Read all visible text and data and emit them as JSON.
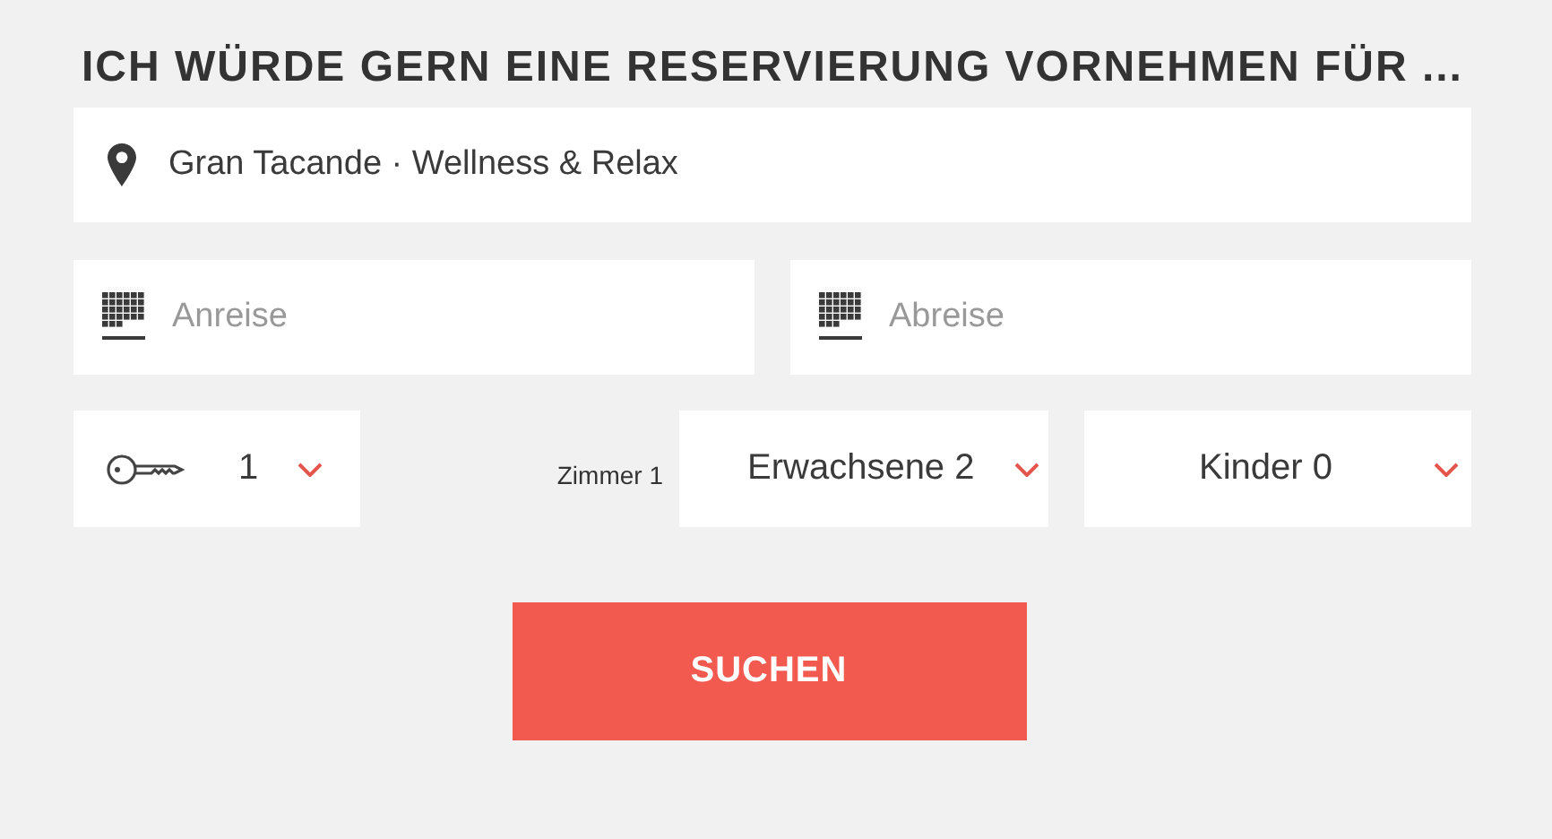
{
  "heading": "ICH WÜRDE GERN EINE RESERVIERUNG VORNEHMEN FÜR ...",
  "location": {
    "value": "Gran Tacande · Wellness & Relax"
  },
  "dates": [
    {
      "placeholder": "Anreise"
    },
    {
      "placeholder": "Abreise"
    }
  ],
  "rooms": {
    "value": "1"
  },
  "room_label": "Zimmer 1",
  "guests": [
    {
      "value": "Erwachsene 2"
    },
    {
      "value": "Kinder 0"
    }
  ],
  "search_button": "SUCHEN"
}
